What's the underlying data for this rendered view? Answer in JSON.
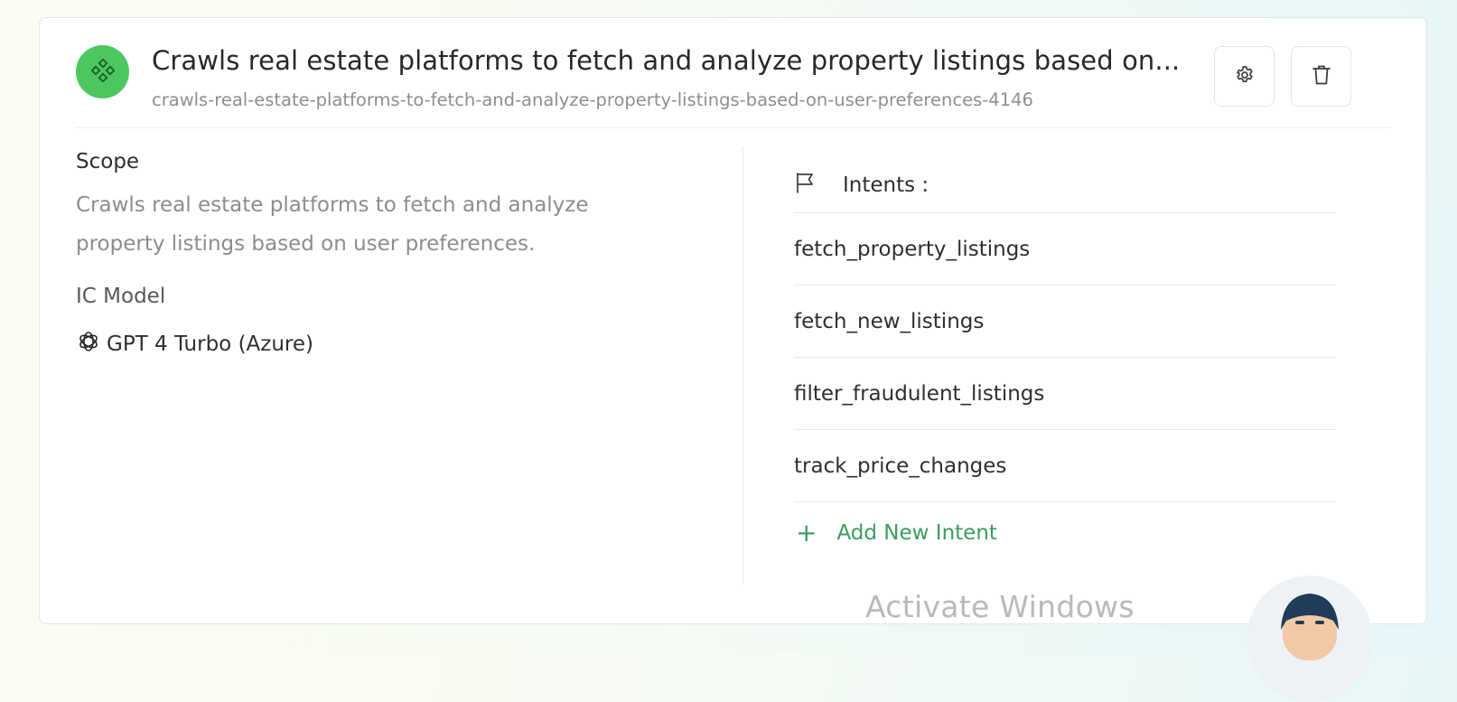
{
  "agent": {
    "title": "Crawls real estate platforms to fetch and analyze property listings based on...",
    "slug": "crawls-real-estate-platforms-to-fetch-and-analyze-property-listings-based-on-user-preferences-4146",
    "icon": "diamond-nodes-icon",
    "accent_color": "#4cc75f"
  },
  "actions": {
    "settings_icon": "gear-icon",
    "delete_icon": "trash-icon"
  },
  "scope": {
    "label": "Scope",
    "text": "Crawls real estate platforms to fetch and analyze property listings based on user preferences."
  },
  "ic_model": {
    "label": "IC Model",
    "value": "GPT 4 Turbo (Azure)",
    "icon": "openai-icon"
  },
  "intents": {
    "label": "Intents :",
    "icon": "flag-icon",
    "items": [
      "fetch_property_listings",
      "fetch_new_listings",
      "filter_fraudulent_listings",
      "track_price_changes"
    ],
    "add_label": "Add New Intent",
    "add_color": "#3a9d5d"
  },
  "watermark": {
    "text": "Activate Windows"
  }
}
